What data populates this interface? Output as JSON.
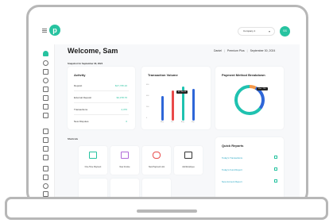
{
  "colors": {
    "accent": "#27c3a0",
    "bar_blue": "#2e66d8",
    "bar_red": "#e94a4a",
    "bar_teal": "#1fc2b0"
  },
  "header": {
    "logo_letter": "p",
    "company_select": "Company 1",
    "avatar_initials": "SS"
  },
  "welcome": {
    "title": "Welcome, Sam",
    "crumb_name": "Daniel",
    "crumb_plan": "Premium Plus",
    "crumb_date": "September 30, 2024",
    "snapshot": "Snapshot for September 30, 2024"
  },
  "activity": {
    "title": "Activity",
    "rows": [
      {
        "label": "Deposit",
        "value": "$17,735.10"
      },
      {
        "label": "External Deposit",
        "value": "$4,378.76"
      },
      {
        "label": "Transactions",
        "value": "2,376"
      },
      {
        "label": "New Disputes",
        "value": "0"
      }
    ]
  },
  "volume": {
    "title": "Transaction Volume",
    "yticks": [
      "600",
      "400",
      "200",
      "0"
    ],
    "tooltip": "$17,835.30",
    "x_labels": [
      "May",
      "Jun",
      "Aug",
      "Sep"
    ]
  },
  "payment": {
    "title": "Payment Method Breakdown",
    "tooltip_a": "Visa",
    "tooltip_b": "73%"
  },
  "shortcuts": {
    "title": "Shortcuts",
    "items": [
      {
        "label": "One-Time Payment",
        "icon": "monitor-icon"
      },
      {
        "label": "New Invoice",
        "icon": "document-icon"
      },
      {
        "label": "New Payment Link",
        "icon": "link-icon"
      },
      {
        "label": "Add Employee",
        "icon": "add-user-icon"
      }
    ]
  },
  "quick_reports": {
    "title": "Quick Reports",
    "links": [
      "Today's Transactions",
      "Today's Fund Report",
      "New Account Report"
    ]
  },
  "chart_data": {
    "type": "bar",
    "title": "Transaction Volume",
    "categories": [
      "May",
      "Jun",
      "Aug",
      "Sep"
    ],
    "series": [
      {
        "name": "",
        "values": [
          400,
          500,
          560,
          520
        ]
      }
    ],
    "ylim": [
      0,
      600
    ]
  }
}
